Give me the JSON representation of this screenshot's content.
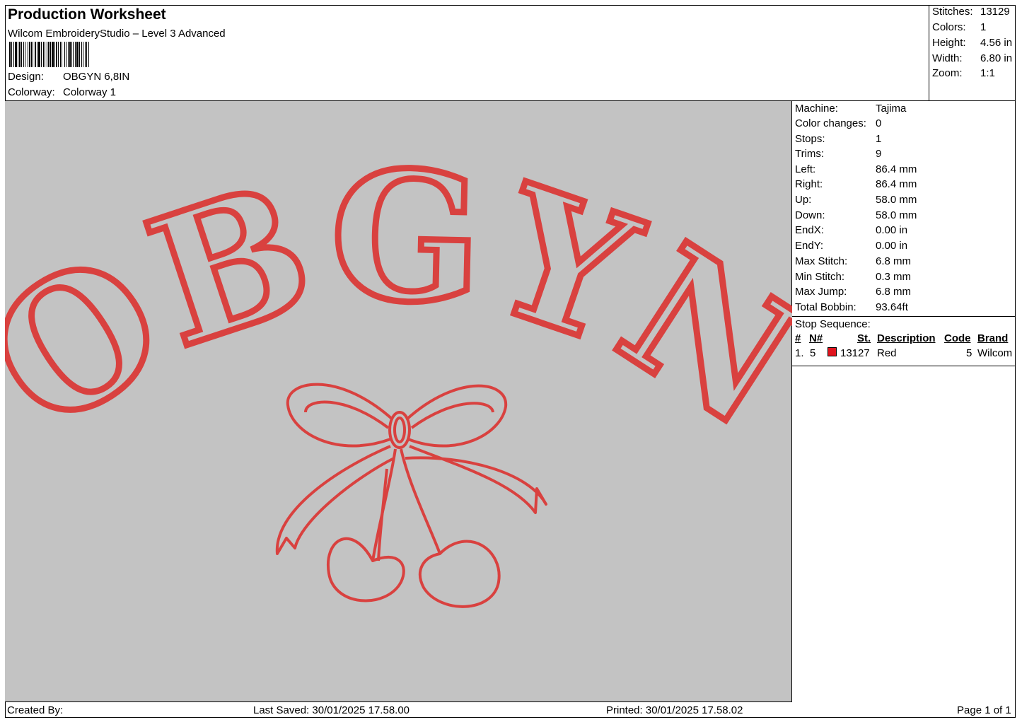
{
  "header": {
    "title": "Production Worksheet",
    "subtitle": "Wilcom EmbroideryStudio – Level 3 Advanced",
    "design_label": "Design:",
    "design_value": "OBGYN 6,8IN",
    "colorway_label": "Colorway:",
    "colorway_value": "Colorway 1"
  },
  "summary": [
    {
      "label": "Stitches:",
      "value": "13129"
    },
    {
      "label": "Colors:",
      "value": "1"
    },
    {
      "label": "Height:",
      "value": "4.56 in"
    },
    {
      "label": "Width:",
      "value": "6.80 in"
    },
    {
      "label": "Zoom:",
      "value": "1:1"
    }
  ],
  "machine_info": [
    {
      "label": "Machine:",
      "value": "Tajima"
    },
    {
      "label": "Color changes:",
      "value": "0"
    },
    {
      "label": "Stops:",
      "value": "1"
    },
    {
      "label": "Trims:",
      "value": "9"
    },
    {
      "label": "Left:",
      "value": "86.4 mm"
    },
    {
      "label": "Right:",
      "value": "86.4 mm"
    },
    {
      "label": "Up:",
      "value": "58.0 mm"
    },
    {
      "label": "Down:",
      "value": "58.0 mm"
    },
    {
      "label": "EndX:",
      "value": "0.00 in"
    },
    {
      "label": "EndY:",
      "value": "0.00 in"
    },
    {
      "label": "Max Stitch:",
      "value": "6.8 mm"
    },
    {
      "label": "Min Stitch:",
      "value": "0.3 mm"
    },
    {
      "label": "Max Jump:",
      "value": "6.8 mm"
    },
    {
      "label": "Total Bobbin:",
      "value": "93.64ft"
    }
  ],
  "stop_sequence": {
    "title": "Stop Sequence:",
    "headers": {
      "num": "#",
      "n": "N#",
      "st": "St.",
      "description": "Description",
      "code": "Code",
      "brand": "Brand"
    },
    "rows": [
      {
        "num": "1.",
        "n": "5",
        "swatch_color": "#e0141e",
        "st": "13127",
        "description": "Red",
        "code": "5",
        "brand": "Wilcom"
      }
    ]
  },
  "design": {
    "text": "OBGYN",
    "thread_color": "#d9413f",
    "background_color": "#c3c3c3"
  },
  "footer": {
    "created_by": "Created By:",
    "last_saved": "Last Saved: 30/01/2025 17.58.00",
    "printed": "Printed: 30/01/2025 17.58.02",
    "page": "Page 1 of 1"
  }
}
